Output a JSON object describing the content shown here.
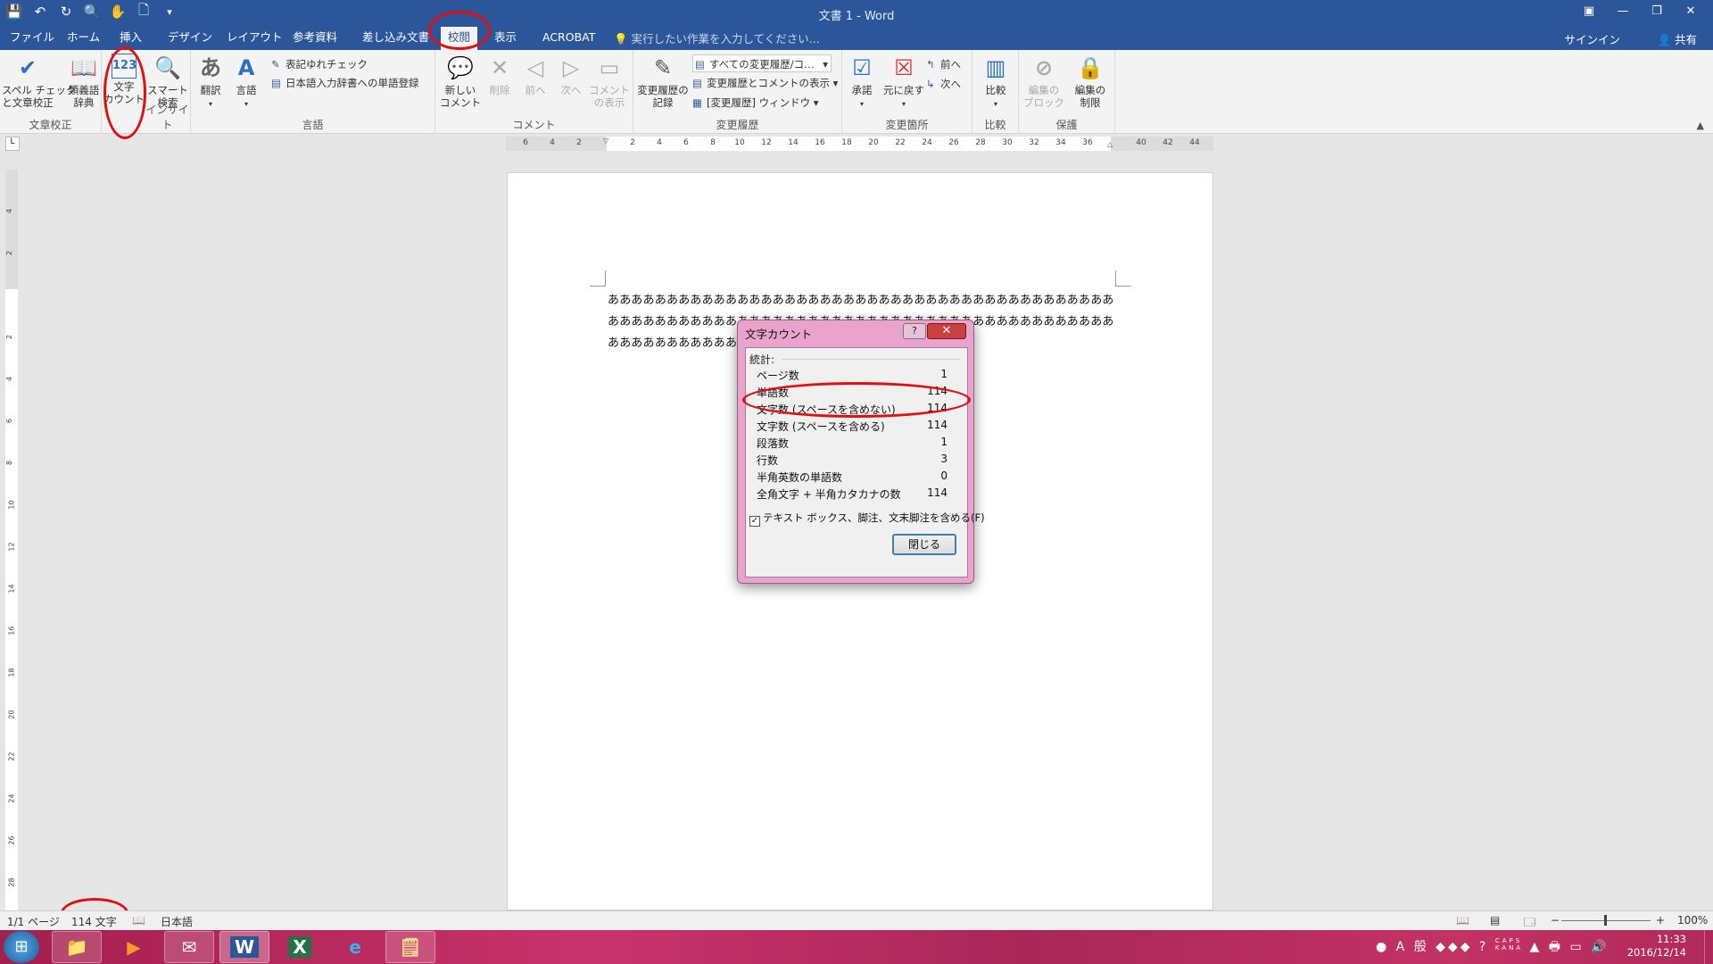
{
  "title_bar": {
    "document_title": "文書 1 - Word"
  },
  "tabs": [
    {
      "label": "ファイル"
    },
    {
      "label": "ホーム"
    },
    {
      "label": "挿入"
    },
    {
      "label": "デザイン"
    },
    {
      "label": "レイアウト"
    },
    {
      "label": "参考資料"
    },
    {
      "label": "差し込み文書"
    },
    {
      "label": "校閲"
    },
    {
      "label": "表示"
    },
    {
      "label": "ACROBAT"
    }
  ],
  "tell_me": "実行したい作業を入力してください...",
  "account": {
    "signin": "サインイン",
    "share": "共有"
  },
  "ribbon": {
    "proofing": {
      "label": "文章校正",
      "spell": "スペル チェック\nと文章校正",
      "thesaurus": "類義語\n辞典",
      "wordcount": "文字\nカウント"
    },
    "insights": {
      "label": "インサイト",
      "smart": "スマート\n検索"
    },
    "language": {
      "label": "言語",
      "translate": "翻訳",
      "lang": "言語",
      "hyoki": "表記ゆれチェック",
      "dict": "日本語入力辞書への単語登録"
    },
    "comments": {
      "label": "コメント",
      "new": "新しい\nコメント",
      "delete": "削除",
      "prev": "前へ",
      "next": "次へ",
      "show": "コメント\nの表示"
    },
    "tracking": {
      "label": "変更履歴",
      "track": "変更履歴の\n記録",
      "markup": "すべての変更履歴/コ…",
      "show_markup": "変更履歴とコメントの表示",
      "pane": "[変更履歴] ウィンドウ"
    },
    "changes": {
      "label": "変更箇所",
      "accept": "承諾",
      "reject": "元に戻す",
      "prev": "前へ",
      "next": "次へ"
    },
    "compare": {
      "label": "比較",
      "compare": "比較"
    },
    "protect": {
      "label": "保護",
      "block": "編集の\nブロック",
      "restrict": "編集の\n制限"
    }
  },
  "ruler_numbers": [
    "6",
    "4",
    "2",
    "",
    "2",
    "4",
    "6",
    "8",
    "10",
    "12",
    "14",
    "16",
    "18",
    "20",
    "22",
    "24",
    "26",
    "28",
    "30",
    "32",
    "34",
    "36",
    "",
    "40",
    "42",
    "44"
  ],
  "vruler_numbers": [
    "4",
    "2",
    "",
    "2",
    "4",
    "6",
    "8",
    "10",
    "12",
    "14",
    "16",
    "18",
    "20",
    "22",
    "24",
    "26",
    "28"
  ],
  "document": {
    "text": "ああああああああああああああああああああああああああああああああああああああああああああああああああああああああああああああああああああああああああああああああああああああああああああああああああああああああああああああああああ↵"
  },
  "dialog": {
    "title": "文字カウント",
    "help": "?",
    "close_x": "✕",
    "section": "統計:",
    "rows": [
      {
        "label": "ページ数",
        "value": "1"
      },
      {
        "label": "単語数",
        "value": "114"
      },
      {
        "label": "文字数 (スペースを含めない)",
        "value": "114"
      },
      {
        "label": "文字数 (スペースを含める)",
        "value": "114"
      },
      {
        "label": "段落数",
        "value": "1"
      },
      {
        "label": "行数",
        "value": "3"
      },
      {
        "label": "半角英数の単語数",
        "value": "0"
      },
      {
        "label": "全角文字 + 半角カタカナの数",
        "value": "114"
      }
    ],
    "checkbox_label": "テキスト ボックス、脚注、文末脚注を含める(F)",
    "checkbox_checked": true,
    "close_button": "閉じる"
  },
  "status_bar": {
    "page": "1/1 ページ",
    "words": "114 文字",
    "language": "日本語",
    "zoom": "100%",
    "zoom_minus": "−",
    "zoom_plus": "+"
  },
  "taskbar": {
    "time": "11:33",
    "date": "2016/12/14",
    "ime": "A 般",
    "caps": "CAPS\nKANA"
  },
  "colors": {
    "word_blue": "#2b579a",
    "annotation_red": "#e01010",
    "dialog_pink": "#e9a3cc"
  }
}
